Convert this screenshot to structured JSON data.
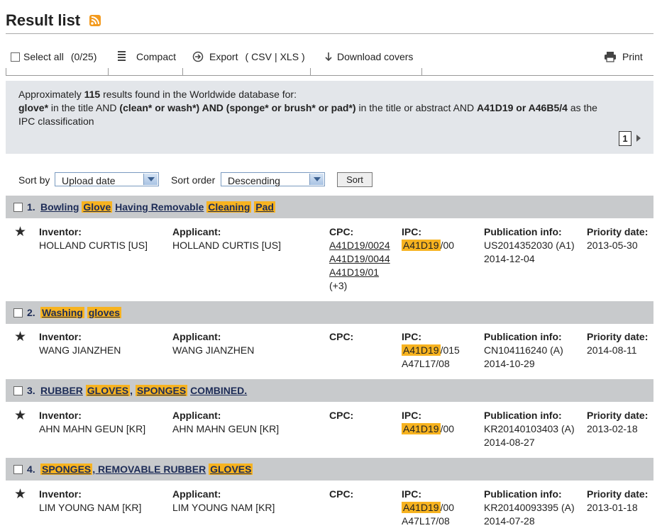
{
  "page": {
    "title": "Result list"
  },
  "toolbar": {
    "select_all": "Select all",
    "select_count": "(0/25)",
    "compact": "Compact",
    "export": "Export",
    "export_paren_open": "(",
    "export_csv": "CSV",
    "export_sep": "|",
    "export_xls": "XLS",
    "export_paren_close": ")",
    "download_covers": "Download covers",
    "print": "Print"
  },
  "search_info": {
    "prefix": "Approximately",
    "count": "115",
    "mid": "results found in the Worldwide database for:",
    "q_title": "glove*",
    "q_title_suffix": "in the title AND",
    "q_abstract": "(clean* or wash*) AND (sponge* or brush* or pad*)",
    "q_abstract_suffix": "in the title or abstract AND",
    "q_ipc": "A41D19 or A46B5/4",
    "q_ipc_suffix": "as the",
    "q_ipc_tail": "IPC classification",
    "page": "1"
  },
  "sort": {
    "sort_by_label": "Sort by",
    "sort_by_value": "Upload date",
    "sort_order_label": "Sort order",
    "sort_order_value": "Descending",
    "button": "Sort"
  },
  "labels": {
    "inventor": "Inventor:",
    "applicant": "Applicant:",
    "cpc": "CPC:",
    "ipc": "IPC:",
    "pubinfo": "Publication info:",
    "priority": "Priority date:"
  },
  "results": [
    {
      "num": "1.",
      "title_parts": [
        "Bowling",
        "Glove",
        "Having Removable",
        "Cleaning",
        "Pad"
      ],
      "inventor": "HOLLAND CURTIS  [US]",
      "applicant": "HOLLAND CURTIS  [US]",
      "cpc": [
        "A41D19/0024",
        "A41D19/0044",
        "A41D19/01"
      ],
      "cpc_more": "(+3)",
      "ipc_hl": "A41D19",
      "ipc_rest": "/00",
      "pub_number": "US2014352030 (A1)",
      "pub_date": "2014-12-04",
      "priority": "2013-05-30"
    },
    {
      "num": "2.",
      "title_parts": [
        "Washing",
        "gloves"
      ],
      "inventor": "WANG JIANZHEN",
      "applicant": "WANG JIANZHEN",
      "ipc_hl": "A41D19",
      "ipc_rest": "/015",
      "ipc_extra": "A47L17/08",
      "pub_number": "CN104116240 (A)",
      "pub_date": "2014-10-29",
      "priority": "2014-08-11"
    },
    {
      "num": "3.",
      "title_parts": [
        "RUBBER",
        "GLOVES",
        ",",
        "SPONGES",
        "COMBINED."
      ],
      "inventor": "AHN MAHN GEUN  [KR]",
      "applicant": "AHN MAHN GEUN  [KR]",
      "ipc_hl": "A41D19",
      "ipc_rest": "/00",
      "pub_number": "KR20140103403 (A)",
      "pub_date": "2014-08-27",
      "priority": "2013-02-18"
    },
    {
      "num": "4.",
      "title_parts": [
        "SPONGES",
        ", REMOVABLE RUBBER",
        "GLOVES"
      ],
      "inventor": "LIM YOUNG NAM  [KR]",
      "applicant": "LIM YOUNG NAM  [KR]",
      "ipc_hl": "A41D19",
      "ipc_rest": "/00",
      "ipc_extra": "A47L17/08",
      "pub_number": "KR20140093395 (A)",
      "pub_date": "2014-07-28",
      "priority": "2013-01-18"
    }
  ],
  "colors": {
    "highlight": "#f7b320",
    "header_bg": "#c8cacc",
    "info_bg": "#e3e6ea",
    "title_link": "#1d2c57"
  }
}
